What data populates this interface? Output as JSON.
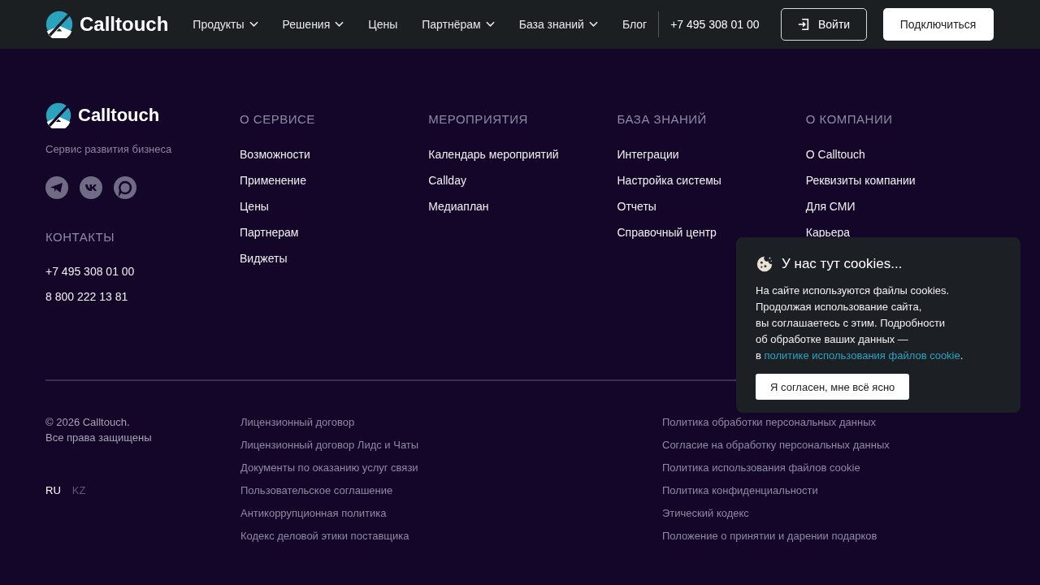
{
  "header": {
    "logo_text": "Calltouch",
    "nav": [
      {
        "label": "Продукты",
        "dropdown": true
      },
      {
        "label": "Решения",
        "dropdown": true
      },
      {
        "label": "Цены",
        "dropdown": false
      },
      {
        "label": "Партнёрам",
        "dropdown": true
      },
      {
        "label": "База знаний",
        "dropdown": true
      },
      {
        "label": "Блог",
        "dropdown": false
      }
    ],
    "phone": "+7 495 308 01 00",
    "login_button": "Войти",
    "connect_button": "Подключиться"
  },
  "footer": {
    "logo_text": "Calltouch",
    "tagline": "Сервис развития бизнеса",
    "socials": [
      {
        "kind": "telegram"
      },
      {
        "kind": "vk"
      },
      {
        "kind": "chat"
      }
    ],
    "contacts_heading": "КОНТАКТЫ",
    "contacts": [
      "+7 495 308 01 00",
      "8 800 222 13 81"
    ],
    "columns": [
      {
        "heading": "О СЕРВИСЕ",
        "links": [
          "Возможности",
          "Применение",
          "Цены",
          "Партнерам",
          "Виджеты"
        ]
      },
      {
        "heading": "МЕРОПРИЯТИЯ",
        "links": [
          "Календарь мероприятий",
          "Callday",
          "Медиаплан"
        ]
      },
      {
        "heading": "БАЗА ЗНАНИЙ",
        "links": [
          "Интеграции",
          "Настройка системы",
          "Отчеты",
          "Справочный центр"
        ]
      },
      {
        "heading": "О КОМПАНИИ",
        "links": [
          "О Calltouch",
          "Реквизиты компании",
          "Для СМИ",
          "Карьера"
        ]
      }
    ],
    "copyright": [
      "© 2026 Calltouch.",
      "Все права защищены"
    ],
    "languages": [
      {
        "label": "RU",
        "selected": true
      },
      {
        "label": "KZ",
        "selected": false
      }
    ],
    "legal_left": [
      "Лицензионный договор",
      "Лицензионный договор Лидс и Чаты",
      "Документы по оказанию услуг связи",
      "Пользовательское соглашение",
      "Антикоррупционная политика",
      "Кодекс деловой этики поставщика"
    ],
    "legal_right": [
      "Политика обработки персональных данных",
      "Согласие на обработку персональных данных",
      "Политика использования файлов cookie",
      "Политика конфиденциальности",
      "Этический кодекс",
      "Положение о принятии и дарении подарков"
    ]
  },
  "cookie_popup": {
    "title": "У нас тут cookies...",
    "text_lines": [
      "На сайте используются файлы cookies.",
      "Продолжая использование сайта,",
      "вы соглашаетесь с этим. Подробности",
      "об обработке ваших данных —"
    ],
    "link_prefix": "в",
    "link": "политике использования файлов cookie",
    "link_suffix": ".",
    "button": "Я согласен, мне всё ясно"
  }
}
